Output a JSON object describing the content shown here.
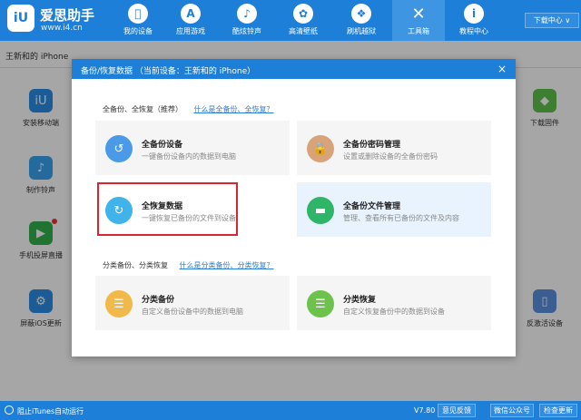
{
  "app": {
    "brand": "爱思助手",
    "url": "www.i4.cn",
    "logo_text": "iU",
    "nav": [
      {
        "label": "我的设备",
        "icon": "apple-icon",
        "glyph": ""
      },
      {
        "label": "应用游戏",
        "icon": "app-store-icon",
        "glyph": "A"
      },
      {
        "label": "酷炫铃声",
        "icon": "bell-icon",
        "glyph": "♪"
      },
      {
        "label": "高清壁纸",
        "icon": "flower-icon",
        "glyph": "✿"
      },
      {
        "label": "刷机越狱",
        "icon": "dropbox-icon",
        "glyph": "❖"
      },
      {
        "label": "工具箱",
        "icon": "tools-icon",
        "glyph": "✕"
      },
      {
        "label": "教程中心",
        "icon": "info-icon",
        "glyph": "i"
      }
    ],
    "download_center": "下载中心 ∨"
  },
  "device": {
    "name": "王新和的 iPhone"
  },
  "background_tools": [
    {
      "label": "安装移动端",
      "icon": "i4-app-icon",
      "glyph": "iU",
      "color": "#2a8ee6"
    },
    {
      "label": "制作铃声",
      "icon": "bell-icon",
      "glyph": "♪",
      "color": "#3aa3f0"
    },
    {
      "label": "手机投屏直播",
      "icon": "screen-mirror-icon",
      "glyph": "▶",
      "color": "#33b14c"
    },
    {
      "label": "屏蔽iOS更新",
      "icon": "gear-icon",
      "glyph": "⚙",
      "color": "#2a8ee6"
    },
    {
      "label": "下载固件",
      "icon": "cube-icon",
      "glyph": "◆",
      "color": "#5ec24a"
    },
    {
      "label": "反激活设备",
      "icon": "phone-icon",
      "glyph": "▯",
      "color": "#5a8fe0"
    }
  ],
  "modal": {
    "title": "备份/恢复数据  （当前设备：王新和的 iPhone）",
    "close": "×",
    "full_section": {
      "title": "全备份、全恢复（推荐）",
      "link": "什么是全备份、全恢复？"
    },
    "category_section": {
      "title": "分类备份、分类恢复",
      "link": "什么是分类备份、分类恢复？"
    },
    "cards": [
      {
        "title": "全备份设备",
        "desc": "一键备份设备内的数据到电脑",
        "icon": "backup-clock-icon",
        "glyph": "↺",
        "color": "#4a9ae8"
      },
      {
        "title": "全备份密码管理",
        "desc": "设置或删除设备的全备份密码",
        "icon": "lock-icon",
        "glyph": "🔒",
        "color": "#d9a37a"
      },
      {
        "title": "全恢复数据",
        "desc": "一键恢复已备份的文件到设备",
        "icon": "restore-clock-icon",
        "glyph": "↻",
        "color": "#3fb3ea"
      },
      {
        "title": "全备份文件管理",
        "desc": "管理、查看所有已备份的文件及内容",
        "icon": "folder-icon",
        "glyph": "▬",
        "color": "#2fb567"
      },
      {
        "title": "分类备份",
        "desc": "自定义备份设备中的数据到电脑",
        "icon": "category-backup-icon",
        "glyph": "☰",
        "color": "#f0b94a"
      },
      {
        "title": "分类恢复",
        "desc": "自定义恢复备份中的数据到设备",
        "icon": "category-restore-icon",
        "glyph": "☰",
        "color": "#6cc24a"
      }
    ]
  },
  "status": {
    "itunes_label": "阻止iTunes自动运行",
    "version": "V7.80",
    "buttons": [
      "意见反馈",
      "微信公众号",
      "检查更新"
    ]
  }
}
